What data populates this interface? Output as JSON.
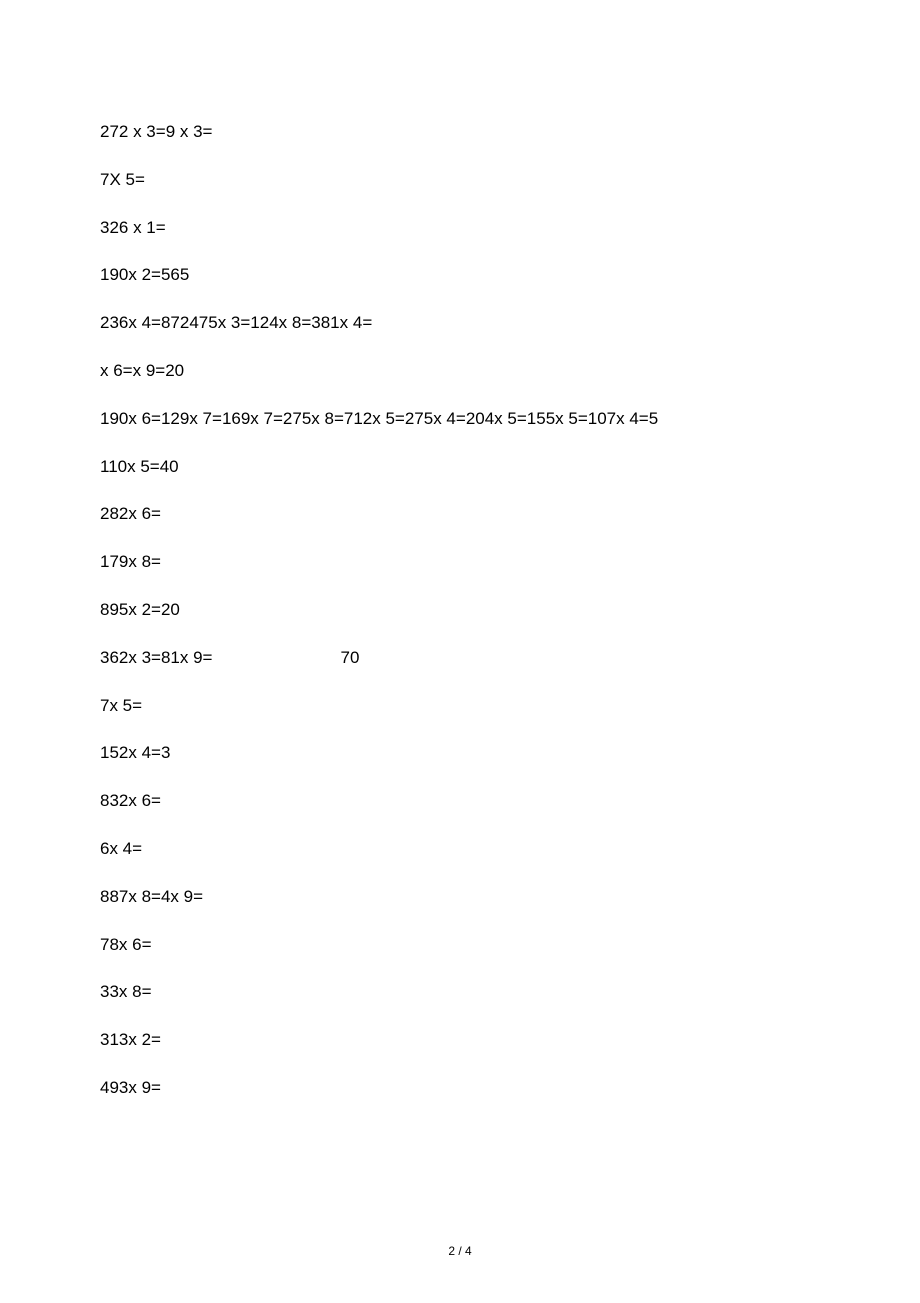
{
  "lines": [
    "272 x 3=9 x 3=",
    "7X 5=",
    "326 x 1=",
    "190x 2=565",
    "236x 4=872475x 3=124x 8=381x 4=",
    "x 6=x 9=20",
    "190x 6=129x 7=169x 7=275x 8=712x 5=275x 4=204x 5=155x 5=107x 4=5",
    "110x 5=40",
    "282x 6=",
    "179x 8=",
    "895x 2=20",
    "",
    "7x 5=",
    "152x 4=3",
    "832x 6=",
    "6x 4=",
    "887x 8=4x 9=",
    "78x 6=",
    "33x 8=",
    "313x 2=",
    "493x 9="
  ],
  "spacedLine": {
    "seg1": "362x 3=81x 9=",
    "seg2": "70"
  },
  "footer": "2 / 4"
}
